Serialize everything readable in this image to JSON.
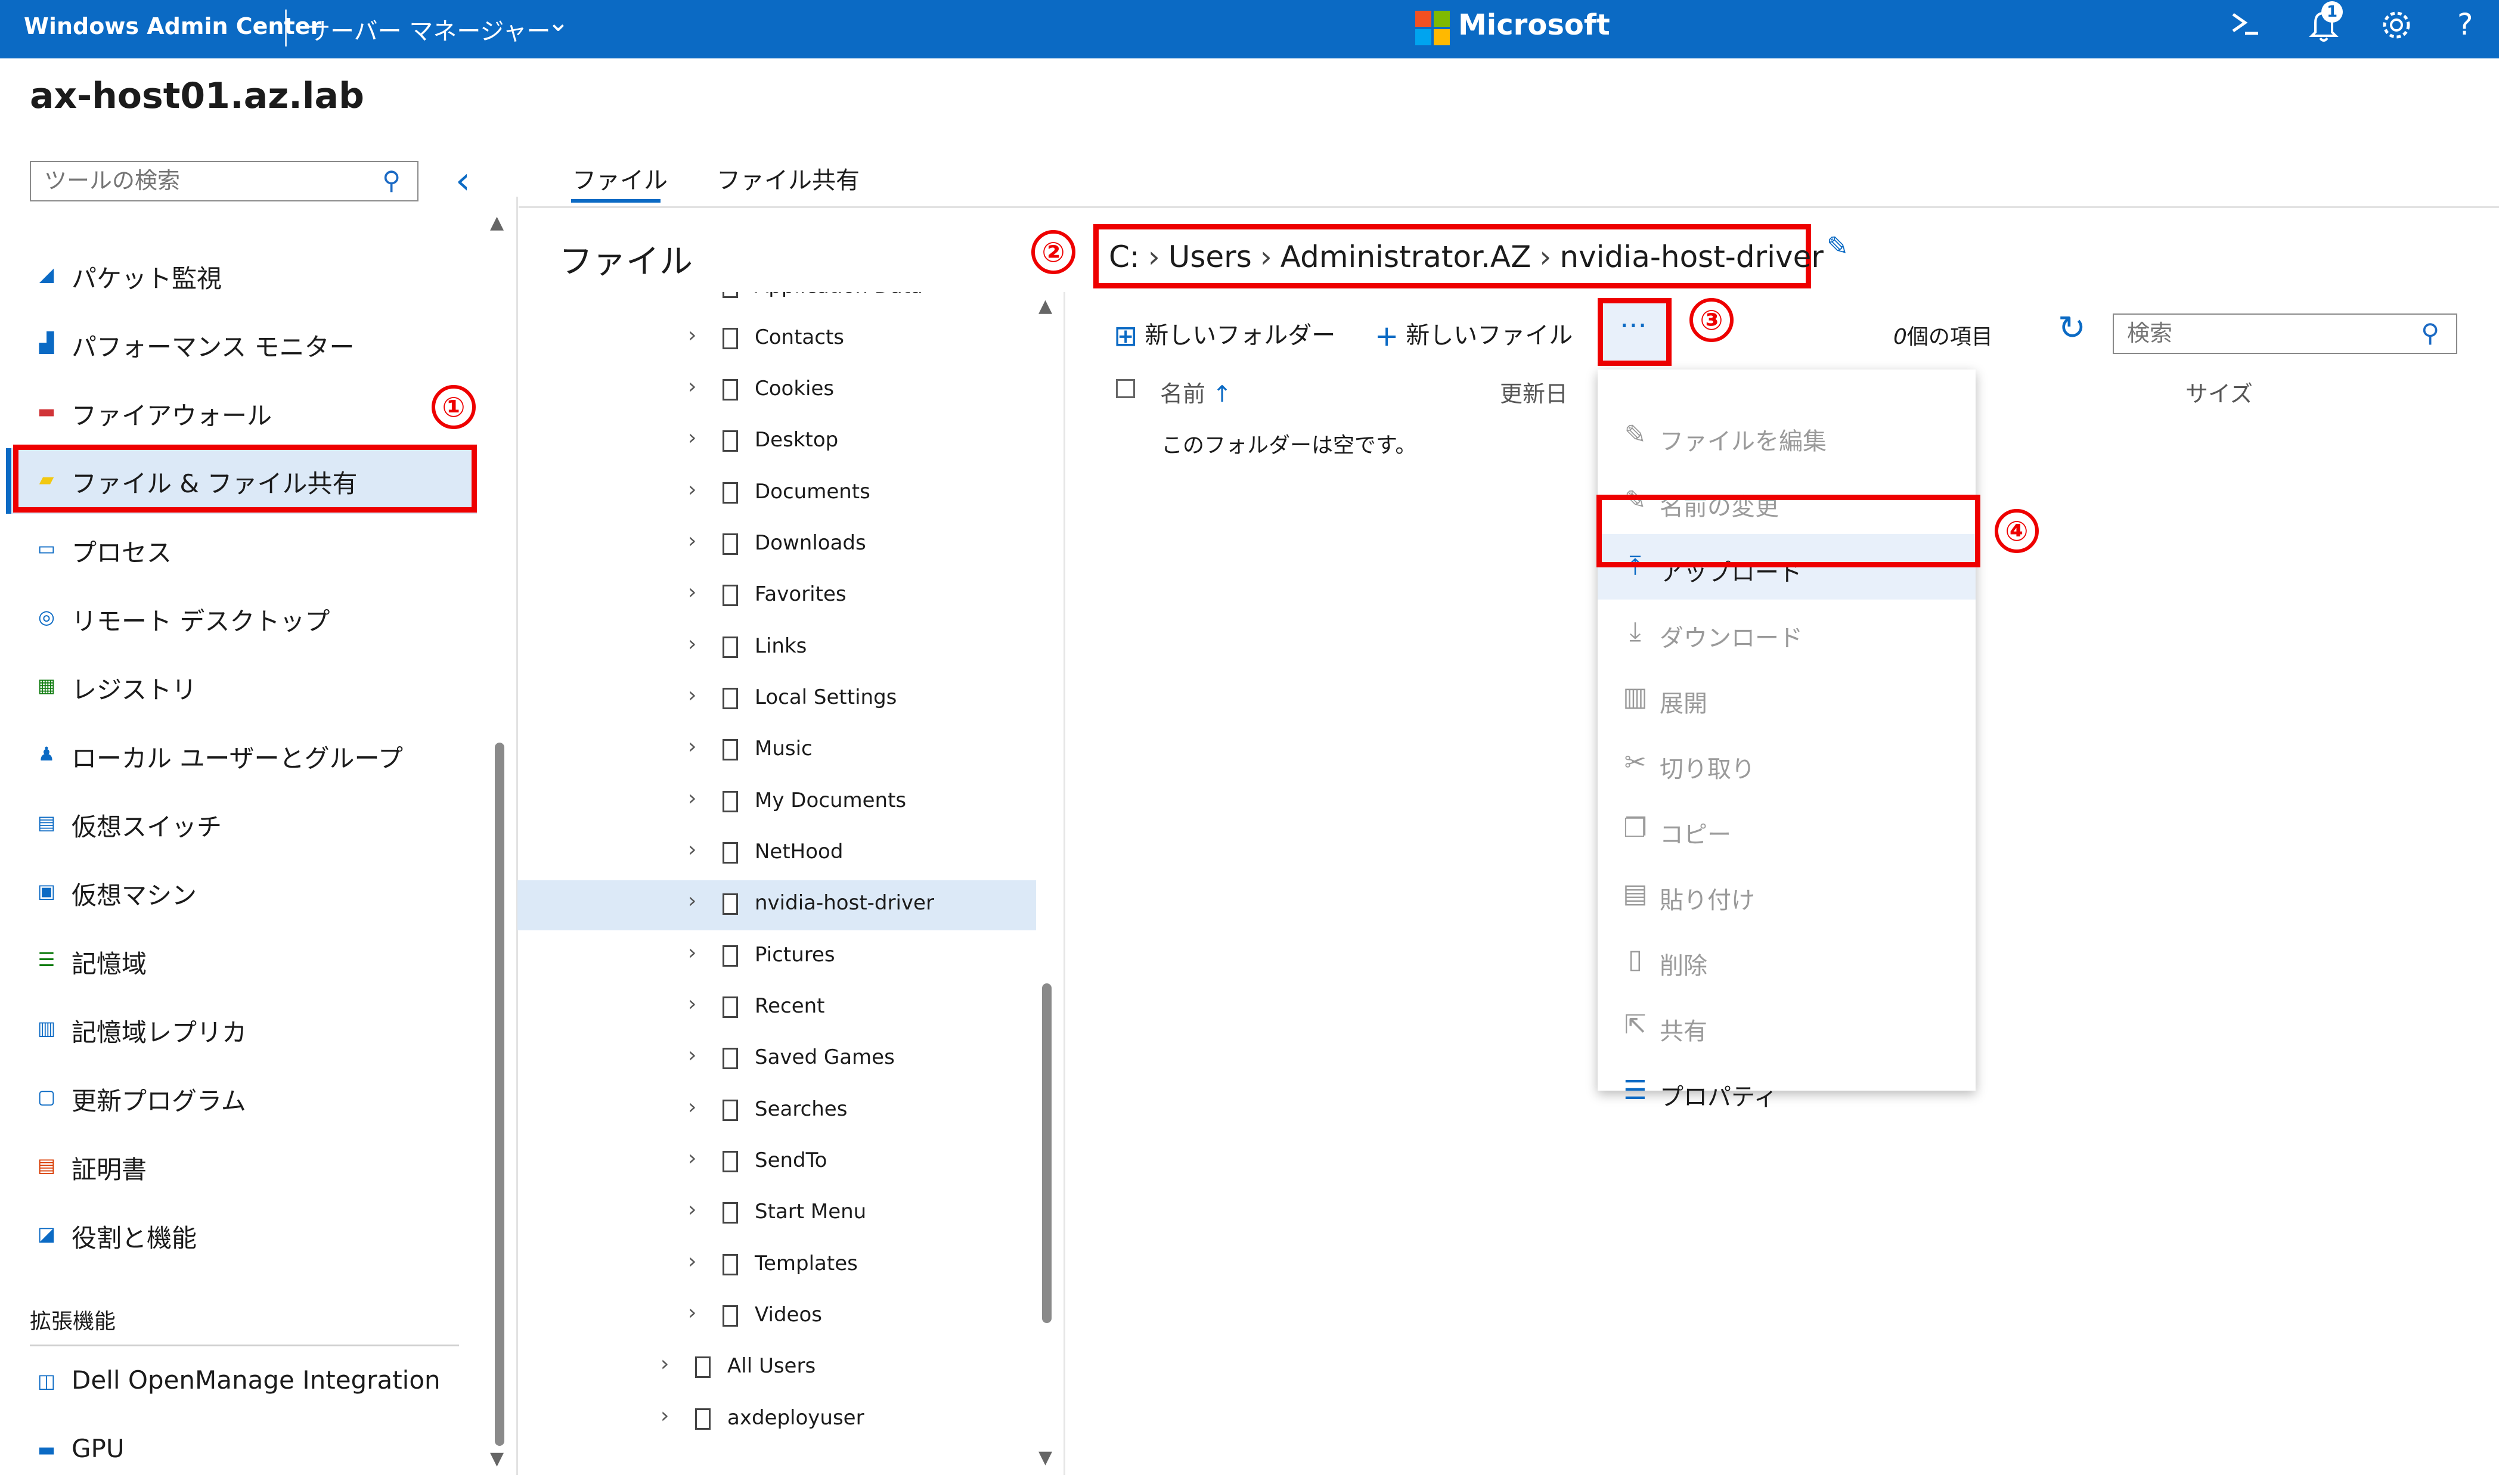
{
  "topbar": {
    "app_title": "Windows Admin Center",
    "server_manager": "サーバー マネージャー",
    "brand": "Microsoft",
    "notification_count": "1",
    "brand_colors": [
      "#f25022",
      "#7fba00",
      "#00a4ef",
      "#ffb900"
    ]
  },
  "host": {
    "name": "ax-host01.az.lab"
  },
  "nav": {
    "search_placeholder": "ツールの検索",
    "items": [
      {
        "label": "パケット監視",
        "icon": "packet-monitor-icon"
      },
      {
        "label": "パフォーマンス モニター",
        "icon": "performance-monitor-icon"
      },
      {
        "label": "ファイアウォール",
        "icon": "firewall-icon"
      },
      {
        "label": "ファイル & ファイル共有",
        "icon": "folder-icon",
        "selected": true
      },
      {
        "label": "プロセス",
        "icon": "process-icon"
      },
      {
        "label": "リモート デスクトップ",
        "icon": "remote-desktop-icon"
      },
      {
        "label": "レジストリ",
        "icon": "registry-icon"
      },
      {
        "label": "ローカル ユーザーとグループ",
        "icon": "users-icon"
      },
      {
        "label": "仮想スイッチ",
        "icon": "virtual-switch-icon"
      },
      {
        "label": "仮想マシン",
        "icon": "virtual-machine-icon"
      },
      {
        "label": "記憶域",
        "icon": "storage-icon"
      },
      {
        "label": "記憶域レプリカ",
        "icon": "storage-replica-icon"
      },
      {
        "label": "更新プログラム",
        "icon": "updates-icon"
      },
      {
        "label": "証明書",
        "icon": "certificate-icon"
      },
      {
        "label": "役割と機能",
        "icon": "roles-features-icon"
      }
    ],
    "extensions_label": "拡張機能",
    "extensions": [
      {
        "label": "Dell OpenManage Integration",
        "icon": "dell-icon"
      },
      {
        "label": "GPU",
        "icon": "gpu-icon"
      }
    ]
  },
  "tabs": [
    {
      "label": "ファイル",
      "active": true
    },
    {
      "label": "ファイル共有",
      "active": false
    }
  ],
  "files": {
    "heading": "ファイル",
    "tree": [
      {
        "label": "Application Data",
        "level": 2,
        "partial": true
      },
      {
        "label": "Contacts",
        "level": 2
      },
      {
        "label": "Cookies",
        "level": 2
      },
      {
        "label": "Desktop",
        "level": 2
      },
      {
        "label": "Documents",
        "level": 2
      },
      {
        "label": "Downloads",
        "level": 2
      },
      {
        "label": "Favorites",
        "level": 2
      },
      {
        "label": "Links",
        "level": 2
      },
      {
        "label": "Local Settings",
        "level": 2
      },
      {
        "label": "Music",
        "level": 2
      },
      {
        "label": "My Documents",
        "level": 2
      },
      {
        "label": "NetHood",
        "level": 2
      },
      {
        "label": "nvidia-host-driver",
        "level": 2,
        "selected": true
      },
      {
        "label": "Pictures",
        "level": 2
      },
      {
        "label": "Recent",
        "level": 2
      },
      {
        "label": "Saved Games",
        "level": 2
      },
      {
        "label": "Searches",
        "level": 2
      },
      {
        "label": "SendTo",
        "level": 2
      },
      {
        "label": "Start Menu",
        "level": 2
      },
      {
        "label": "Templates",
        "level": 2
      },
      {
        "label": "Videos",
        "level": 2
      },
      {
        "label": "All Users",
        "level": 1
      },
      {
        "label": "axdeployuser",
        "level": 1
      }
    ],
    "breadcrumb": [
      "C:",
      "Users",
      "Administrator.AZ",
      "nvidia-host-driver"
    ],
    "toolbar": {
      "new_folder": "新しいフォルダー",
      "new_file": "新しいファイル",
      "more": "···",
      "item_count_num": "0",
      "item_count_label": "個の項目",
      "search_placeholder": "検索"
    },
    "columns": {
      "name": "名前",
      "modified": "更新日",
      "size": "サイズ"
    },
    "empty_message": "このフォルダーは空です。"
  },
  "menu": {
    "items": [
      {
        "label": "ファイルを編集",
        "icon": "pencil-icon",
        "enabled": false
      },
      {
        "label": "名前の変更",
        "icon": "rename-icon",
        "enabled": false
      },
      {
        "label": "アップロード",
        "icon": "upload-icon",
        "enabled": true,
        "highlighted": true
      },
      {
        "label": "ダウンロード",
        "icon": "download-icon",
        "enabled": false
      },
      {
        "label": "展開",
        "icon": "extract-icon",
        "enabled": false
      },
      {
        "label": "切り取り",
        "icon": "cut-icon",
        "enabled": false
      },
      {
        "label": "コピー",
        "icon": "copy-icon",
        "enabled": false
      },
      {
        "label": "貼り付け",
        "icon": "paste-icon",
        "enabled": false
      },
      {
        "label": "削除",
        "icon": "delete-icon",
        "enabled": false
      },
      {
        "label": "共有",
        "icon": "share-icon",
        "enabled": false
      },
      {
        "label": "プロパティ",
        "icon": "properties-icon",
        "enabled": true
      }
    ]
  },
  "annotations": [
    "①",
    "②",
    "③",
    "④"
  ]
}
